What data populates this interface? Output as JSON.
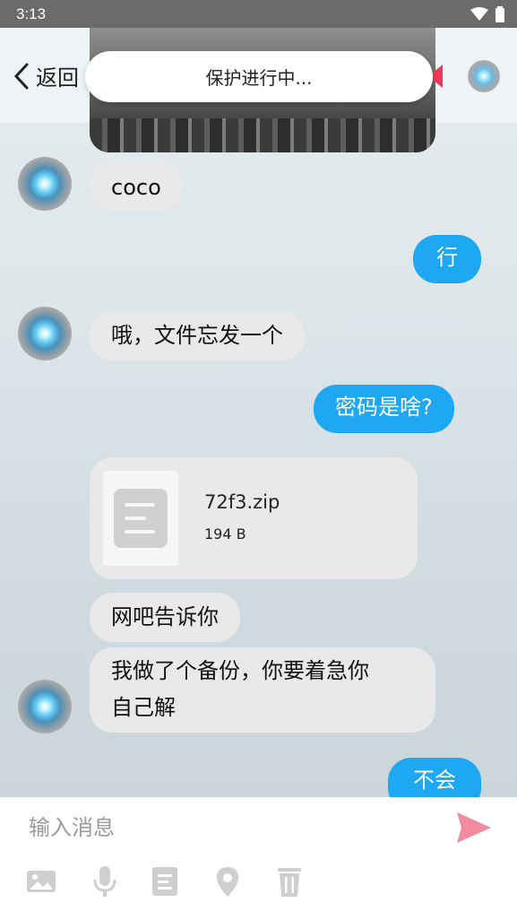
{
  "status_bar": {
    "time": "3:13"
  },
  "header": {
    "back_label": "返回"
  },
  "toast": {
    "text": "保护进行中..."
  },
  "messages": [
    {
      "side": "left",
      "text": "coco"
    },
    {
      "side": "right",
      "text": "行"
    },
    {
      "side": "left",
      "text": "哦，文件忘发一个"
    },
    {
      "side": "right",
      "text": "密码是啥?"
    },
    {
      "side": "left",
      "type": "file",
      "file_name": "72f3.zip",
      "file_size": "194 B"
    },
    {
      "side": "left",
      "text": "网吧告诉你"
    },
    {
      "side": "left",
      "text_line1": "我做了个备份，你要着急你",
      "text_line2": "自己解"
    },
    {
      "side": "right",
      "text": "不会"
    }
  ],
  "input": {
    "placeholder": "输入消息"
  },
  "toolbar": {
    "icons": [
      "image-icon",
      "microphone-icon",
      "document-icon",
      "location-icon",
      "trash-icon",
      "send-icon"
    ]
  },
  "colors": {
    "accent": "#1ea7f2",
    "send": "#f06b87",
    "bubble_left": "#e9e9ea"
  }
}
